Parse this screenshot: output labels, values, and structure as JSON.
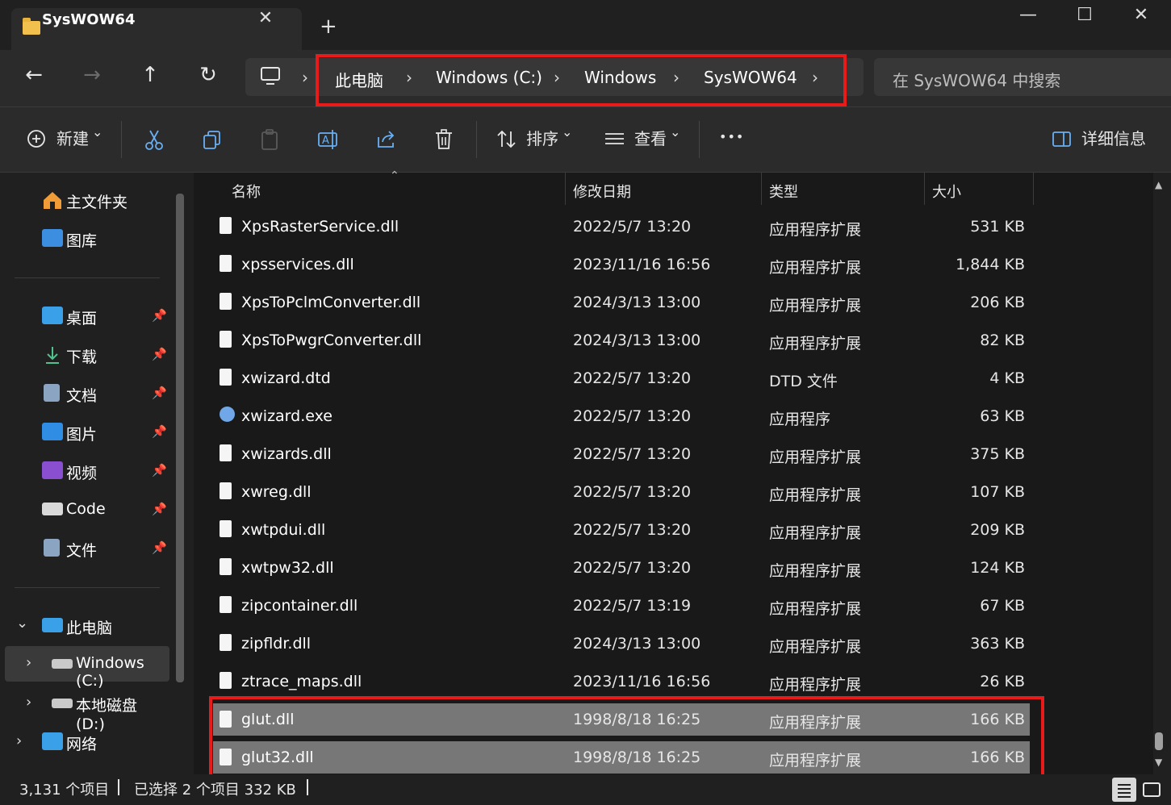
{
  "window": {
    "tab_title": "SysWOW64",
    "tab_close": "✕",
    "new_tab": "+",
    "minimize": "—",
    "maximize": "☐",
    "close": "✕"
  },
  "nav": {
    "back": "←",
    "forward": "→",
    "up": "↑",
    "refresh": "↻",
    "breadcrumbs": [
      "此电脑",
      "Windows (C:)",
      "Windows",
      "SysWOW64"
    ],
    "chevron": "›",
    "search_placeholder": "在 SysWOW64 中搜索"
  },
  "toolbar": {
    "new_label": "新建",
    "sort_label": "排序",
    "view_label": "查看",
    "more_label": "•••",
    "details_label": "详细信息",
    "caret": "⌄"
  },
  "sidebar": {
    "top": [
      {
        "label": "主文件夹",
        "icon": "home-icon"
      },
      {
        "label": "图库",
        "icon": "gallery-icon"
      }
    ],
    "pinned": [
      {
        "label": "桌面",
        "icon": "desktop-icon"
      },
      {
        "label": "下载",
        "icon": "download-icon"
      },
      {
        "label": "文档",
        "icon": "document-icon"
      },
      {
        "label": "图片",
        "icon": "picture-icon"
      },
      {
        "label": "视频",
        "icon": "video-icon"
      },
      {
        "label": "Code",
        "icon": "folder-icon"
      },
      {
        "label": "文件",
        "icon": "document-icon"
      }
    ],
    "tree": [
      {
        "label": "此电脑",
        "icon": "computer-icon"
      },
      {
        "label": "Windows (C:)",
        "icon": "drive-icon"
      },
      {
        "label": "本地磁盘 (D:)",
        "icon": "drive-icon"
      },
      {
        "label": "网络",
        "icon": "network-icon"
      }
    ]
  },
  "columns": {
    "name": "名称",
    "date": "修改日期",
    "type": "类型",
    "size": "大小"
  },
  "files": [
    {
      "name": "XpsRasterService.dll",
      "date": "2022/5/7 13:20",
      "type": "应用程序扩展",
      "size": "531 KB"
    },
    {
      "name": "xpsservices.dll",
      "date": "2023/11/16 16:56",
      "type": "应用程序扩展",
      "size": "1,844 KB"
    },
    {
      "name": "XpsToPclmConverter.dll",
      "date": "2024/3/13 13:00",
      "type": "应用程序扩展",
      "size": "206 KB"
    },
    {
      "name": "XpsToPwgrConverter.dll",
      "date": "2024/3/13 13:00",
      "type": "应用程序扩展",
      "size": "82 KB"
    },
    {
      "name": "xwizard.dtd",
      "date": "2022/5/7 13:20",
      "type": "DTD 文件",
      "size": "4 KB"
    },
    {
      "name": "xwizard.exe",
      "date": "2022/5/7 13:20",
      "type": "应用程序",
      "size": "63 KB"
    },
    {
      "name": "xwizards.dll",
      "date": "2022/5/7 13:20",
      "type": "应用程序扩展",
      "size": "375 KB"
    },
    {
      "name": "xwreg.dll",
      "date": "2022/5/7 13:20",
      "type": "应用程序扩展",
      "size": "107 KB"
    },
    {
      "name": "xwtpdui.dll",
      "date": "2022/5/7 13:20",
      "type": "应用程序扩展",
      "size": "209 KB"
    },
    {
      "name": "xwtpw32.dll",
      "date": "2022/5/7 13:20",
      "type": "应用程序扩展",
      "size": "124 KB"
    },
    {
      "name": "zipcontainer.dll",
      "date": "2022/5/7 13:19",
      "type": "应用程序扩展",
      "size": "67 KB"
    },
    {
      "name": "zipfldr.dll",
      "date": "2024/3/13 13:00",
      "type": "应用程序扩展",
      "size": "363 KB"
    },
    {
      "name": "ztrace_maps.dll",
      "date": "2023/11/16 16:56",
      "type": "应用程序扩展",
      "size": "26 KB"
    },
    {
      "name": "glut.dll",
      "date": "1998/8/18 16:25",
      "type": "应用程序扩展",
      "size": "166 KB",
      "selected": true
    },
    {
      "name": "glut32.dll",
      "date": "1998/8/18 16:25",
      "type": "应用程序扩展",
      "size": "166 KB",
      "selected": true
    }
  ],
  "status": {
    "item_count": "3,131 个项目",
    "selected": "已选择 2 个项目  332 KB"
  },
  "colors": {
    "highlight_box": "#e81a1a",
    "selection": "#777777"
  }
}
